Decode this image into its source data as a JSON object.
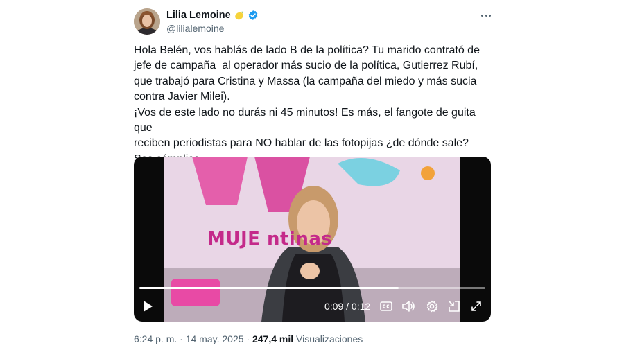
{
  "author": {
    "name": "Lilia Lemoine",
    "handle": "@lilialemoine",
    "badge_emoji": "lemon-emoji-icon",
    "verified_icon": "verified-badge-icon"
  },
  "tweet": {
    "text": "Hola Belén, vos hablás de lado B de la política? Tu marido contrató de\njefe de campaña  al operador más sucio de la política, Gutierrez Rubí,\nque trabajó para Cristina y Massa (la campaña del miedo y más sucia\ncontra Javier Milei).\n¡Vos de este lado no durás ni 45 minutos! Es más, el fangote de guita que\nreciben periodistas para NO hablar de las fotopijas ¿de dónde sale?\nSos cómplice."
  },
  "video": {
    "overlay_text": "MUJE            ntinas",
    "current_time": "0:09",
    "separator": " / ",
    "duration": "0:12",
    "progress": 0.75
  },
  "footer": {
    "time": "6:24 p. m.",
    "dot": " · ",
    "date": "14 may. 2025",
    "views_count": "247,4 mil",
    "views_label": "Visualizaciones"
  },
  "colors": {
    "text": "#0f1419",
    "secondary": "#536471",
    "verified": "#1d9bf0",
    "show_pink": "#c42a8a"
  }
}
